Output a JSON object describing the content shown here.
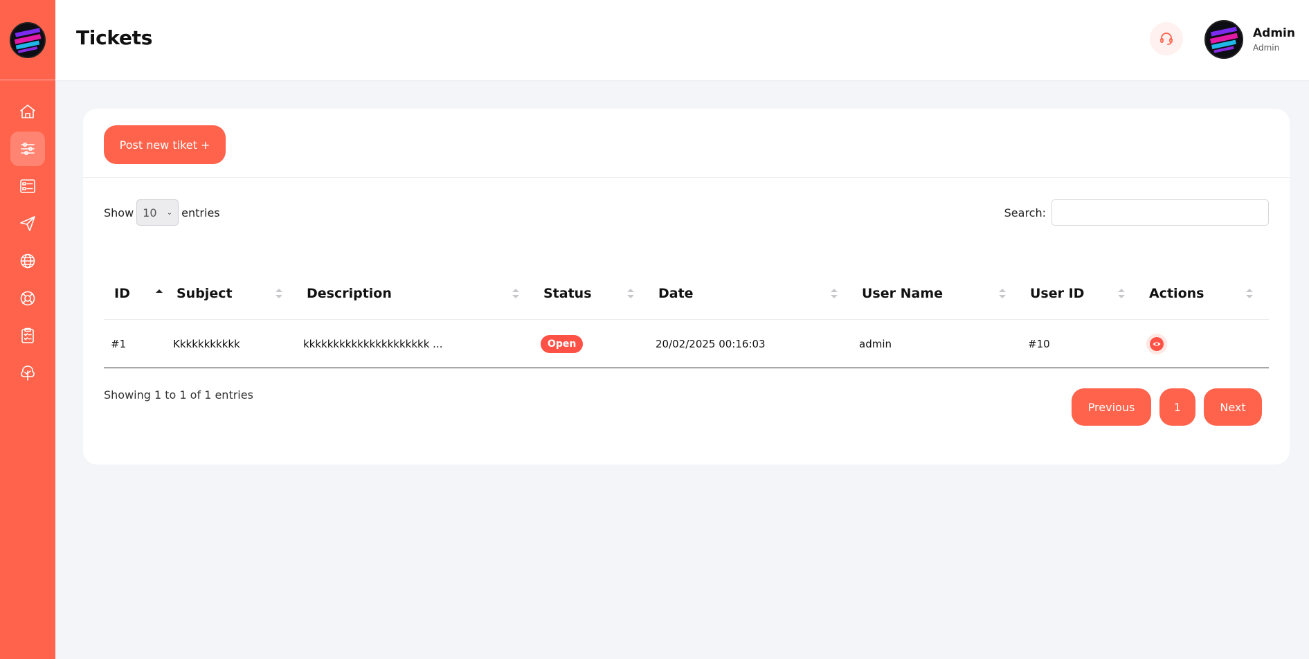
{
  "header": {
    "title": "Tickets"
  },
  "user": {
    "name": "Admin",
    "role": "Admin"
  },
  "sidebar": {
    "items": [
      {
        "icon": "home-icon"
      },
      {
        "icon": "sliders-icon",
        "active": true
      },
      {
        "icon": "list-icon"
      },
      {
        "icon": "send-icon"
      },
      {
        "icon": "globe-icon"
      },
      {
        "icon": "support-icon"
      },
      {
        "icon": "clipboard-icon"
      },
      {
        "icon": "tree-icon"
      }
    ]
  },
  "toolbar": {
    "post_label": "Post new tiket +"
  },
  "length_ctrl": {
    "show_label": "Show",
    "value": "10",
    "entries_label": "entries"
  },
  "search": {
    "label": "Search:",
    "value": "",
    "placeholder": ""
  },
  "table": {
    "columns": [
      "ID",
      "Subject",
      "Description",
      "Status",
      "Date",
      "User Name",
      "User ID",
      "Actions"
    ],
    "rows": [
      {
        "id": "#1",
        "subject": "Kkkkkkkkkkk",
        "description": "kkkkkkkkkkkkkkkkkkkkk ...",
        "status": "Open",
        "date": "20/02/2025 00:16:03",
        "user_name": "admin",
        "user_id": "#10"
      }
    ]
  },
  "footer": {
    "info": "Showing 1 to 1 of 1 entries"
  },
  "pagination": {
    "previous": "Previous",
    "page": "1",
    "next": "Next"
  },
  "colors": {
    "accent": "#ff634b",
    "badge": "#ff5146",
    "background": "#f4f5f8"
  }
}
